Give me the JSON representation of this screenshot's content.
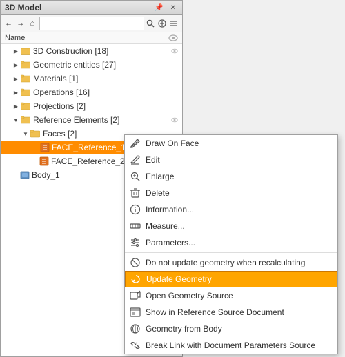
{
  "panel": {
    "title": "3D Model",
    "toolbar": {
      "back_label": "←",
      "forward_label": "→",
      "home_label": "⌂",
      "search_placeholder": "",
      "search_icon": "search-icon",
      "add_icon": "plus-icon",
      "menu_icon": "list-icon"
    },
    "columns": {
      "name_label": "Name",
      "visibility_label": "👁"
    },
    "tree_items": [
      {
        "id": "3d-construction",
        "label": "3D Construction [18]",
        "indent": 1,
        "arrow": "closed",
        "icon": "folder",
        "has_eye": true
      },
      {
        "id": "geometric-entities",
        "label": "Geometric entities [27]",
        "indent": 1,
        "arrow": "closed",
        "icon": "folder",
        "has_eye": false
      },
      {
        "id": "materials",
        "label": "Materials [1]",
        "indent": 1,
        "arrow": "closed",
        "icon": "folder",
        "has_eye": false
      },
      {
        "id": "operations",
        "label": "Operations [16]",
        "indent": 1,
        "arrow": "closed",
        "icon": "folder",
        "has_eye": false
      },
      {
        "id": "projections",
        "label": "Projections [2]",
        "indent": 1,
        "arrow": "closed",
        "icon": "folder",
        "has_eye": false
      },
      {
        "id": "reference-elements",
        "label": "Reference Elements [2]",
        "indent": 1,
        "arrow": "open",
        "icon": "folder",
        "has_eye": true
      },
      {
        "id": "faces",
        "label": "Faces [2]",
        "indent": 2,
        "arrow": "open",
        "icon": "folder",
        "has_eye": false
      },
      {
        "id": "face-ref-1",
        "label": "FACE_Reference_1",
        "indent": 3,
        "arrow": "leaf",
        "icon": "face",
        "selected": "orange",
        "has_eye": false
      },
      {
        "id": "face-ref-2",
        "label": "FACE_Reference_2",
        "indent": 3,
        "arrow": "leaf",
        "icon": "face",
        "has_eye": false
      },
      {
        "id": "body-1",
        "label": "Body_1",
        "indent": 1,
        "arrow": "leaf",
        "icon": "body",
        "has_eye": false
      }
    ]
  },
  "context_menu": {
    "items": [
      {
        "id": "draw-on-face",
        "label": "Draw On Face",
        "icon": "draw-icon"
      },
      {
        "id": "edit",
        "label": "Edit",
        "icon": "edit-icon"
      },
      {
        "id": "enlarge",
        "label": "Enlarge",
        "icon": "enlarge-icon"
      },
      {
        "id": "delete",
        "label": "Delete",
        "icon": "delete-icon"
      },
      {
        "id": "information",
        "label": "Information...",
        "icon": "info-icon"
      },
      {
        "id": "measure",
        "label": "Measure...",
        "icon": "measure-icon"
      },
      {
        "id": "parameters",
        "label": "Parameters...",
        "icon": "params-icon"
      },
      {
        "id": "separator1",
        "type": "separator"
      },
      {
        "id": "do-not-update",
        "label": "Do not update geometry when recalculating",
        "icon": "no-update-icon"
      },
      {
        "id": "update-geometry",
        "label": "Update Geometry",
        "icon": "update-icon",
        "highlighted": true
      },
      {
        "id": "open-geometry-source",
        "label": "Open Geometry Source",
        "icon": "open-source-icon"
      },
      {
        "id": "show-in-reference",
        "label": "Show in Reference Source Document",
        "icon": "show-ref-icon"
      },
      {
        "id": "geometry-from-body",
        "label": "Geometry from Body",
        "icon": "geo-body-icon"
      },
      {
        "id": "break-link",
        "label": "Break Link with Document Parameters Source",
        "icon": "break-link-icon"
      }
    ]
  }
}
